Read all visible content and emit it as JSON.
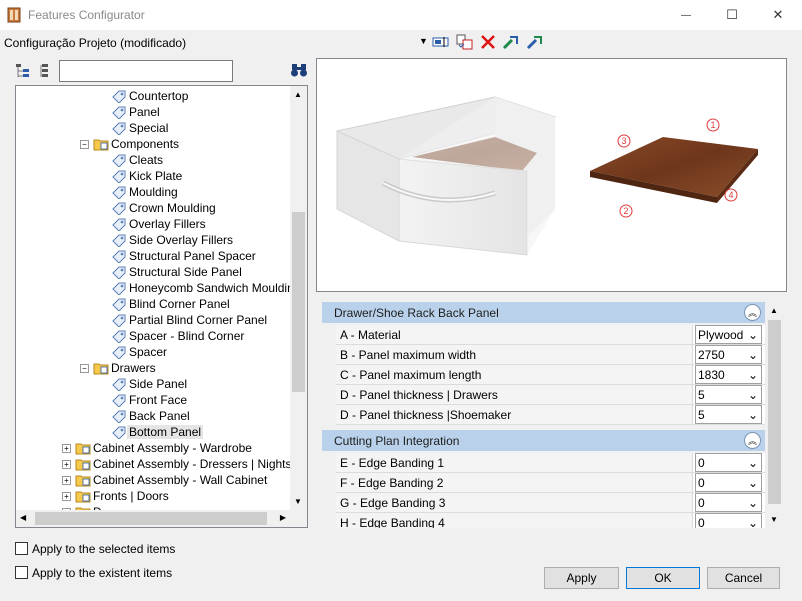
{
  "window": {
    "title": "Features Configurator",
    "minimize_glyph": "—",
    "maximize_glyph": "☐",
    "close_glyph": "✕"
  },
  "project": {
    "label": "Configuração Projeto (modificado)"
  },
  "toolbar": {
    "icons": [
      "edit-field-icon",
      "copy-paste-icon",
      "delete-icon",
      "import-icon",
      "export-icon"
    ]
  },
  "search": {
    "value": ""
  },
  "tree": {
    "items": [
      {
        "label": "Countertop",
        "level": 4,
        "type": "tag"
      },
      {
        "label": "Panel",
        "level": 4,
        "type": "tag"
      },
      {
        "label": "Special",
        "level": 4,
        "type": "tag"
      },
      {
        "label": "Components",
        "level": 3,
        "type": "folder",
        "expanded": true
      },
      {
        "label": "Cleats",
        "level": 4,
        "type": "tag"
      },
      {
        "label": "Kick Plate",
        "level": 4,
        "type": "tag"
      },
      {
        "label": "Moulding",
        "level": 4,
        "type": "tag"
      },
      {
        "label": "Crown Moulding",
        "level": 4,
        "type": "tag"
      },
      {
        "label": "Overlay Fillers",
        "level": 4,
        "type": "tag"
      },
      {
        "label": "Side Overlay Fillers",
        "level": 4,
        "type": "tag"
      },
      {
        "label": "Structural Panel Spacer",
        "level": 4,
        "type": "tag"
      },
      {
        "label": "Structural Side Panel",
        "level": 4,
        "type": "tag"
      },
      {
        "label": "Honeycomb Sandwich Moulding",
        "level": 4,
        "type": "tag"
      },
      {
        "label": "Blind Corner Panel",
        "level": 4,
        "type": "tag"
      },
      {
        "label": "Partial Blind Corner Panel",
        "level": 4,
        "type": "tag"
      },
      {
        "label": "Spacer - Blind Corner",
        "level": 4,
        "type": "tag"
      },
      {
        "label": "Spacer",
        "level": 4,
        "type": "tag"
      },
      {
        "label": "Drawers",
        "level": 3,
        "type": "folder",
        "expanded": true
      },
      {
        "label": "Side Panel",
        "level": 4,
        "type": "tag"
      },
      {
        "label": "Front Face",
        "level": 4,
        "type": "tag"
      },
      {
        "label": "Back Panel",
        "level": 4,
        "type": "tag"
      },
      {
        "label": "Bottom Panel",
        "level": 4,
        "type": "tag",
        "selected": true
      },
      {
        "label": "Cabinet Assembly - Wardrobe",
        "level": 2,
        "type": "folder",
        "expanded": false
      },
      {
        "label": "Cabinet Assembly - Dressers | Nightstand",
        "level": 2,
        "type": "folder",
        "expanded": false
      },
      {
        "label": "Cabinet Assembly - Wall Cabinet",
        "level": 2,
        "type": "folder",
        "expanded": false
      },
      {
        "label": "Fronts | Doors",
        "level": 2,
        "type": "folder",
        "expanded": false
      },
      {
        "label": "D",
        "level": 2,
        "type": "folder",
        "expanded": false
      }
    ]
  },
  "preview": {
    "markers": [
      "1",
      "2",
      "3",
      "4"
    ]
  },
  "properties": {
    "categories": [
      {
        "name": "Drawer/Shoe Rack Back Panel",
        "rows": [
          {
            "name": "A - Material",
            "value": "Plywood"
          },
          {
            "name": "B - Panel maximum width",
            "value": "2750"
          },
          {
            "name": "C - Panel maximum length",
            "value": "1830"
          },
          {
            "name": "D - Panel thickness | Drawers",
            "value": "5"
          },
          {
            "name": "D - Panel thickness |Shoemaker",
            "value": "5"
          }
        ]
      },
      {
        "name": "Cutting Plan Integration",
        "rows": [
          {
            "name": "E - Edge Banding 1",
            "value": "0"
          },
          {
            "name": "F - Edge Banding 2",
            "value": "0"
          },
          {
            "name": "G - Edge Banding 3",
            "value": "0"
          },
          {
            "name": "H - Edge Banding 4",
            "value": "0"
          }
        ]
      }
    ]
  },
  "options": {
    "apply_selected": "Apply to the selected items",
    "apply_existent": "Apply to the existent items"
  },
  "buttons": {
    "apply": "Apply",
    "ok": "OK",
    "cancel": "Cancel"
  },
  "colors": {
    "category_bg": "#b9d1ea",
    "wood": "#7a3f22",
    "marker": "#e03a3a"
  }
}
